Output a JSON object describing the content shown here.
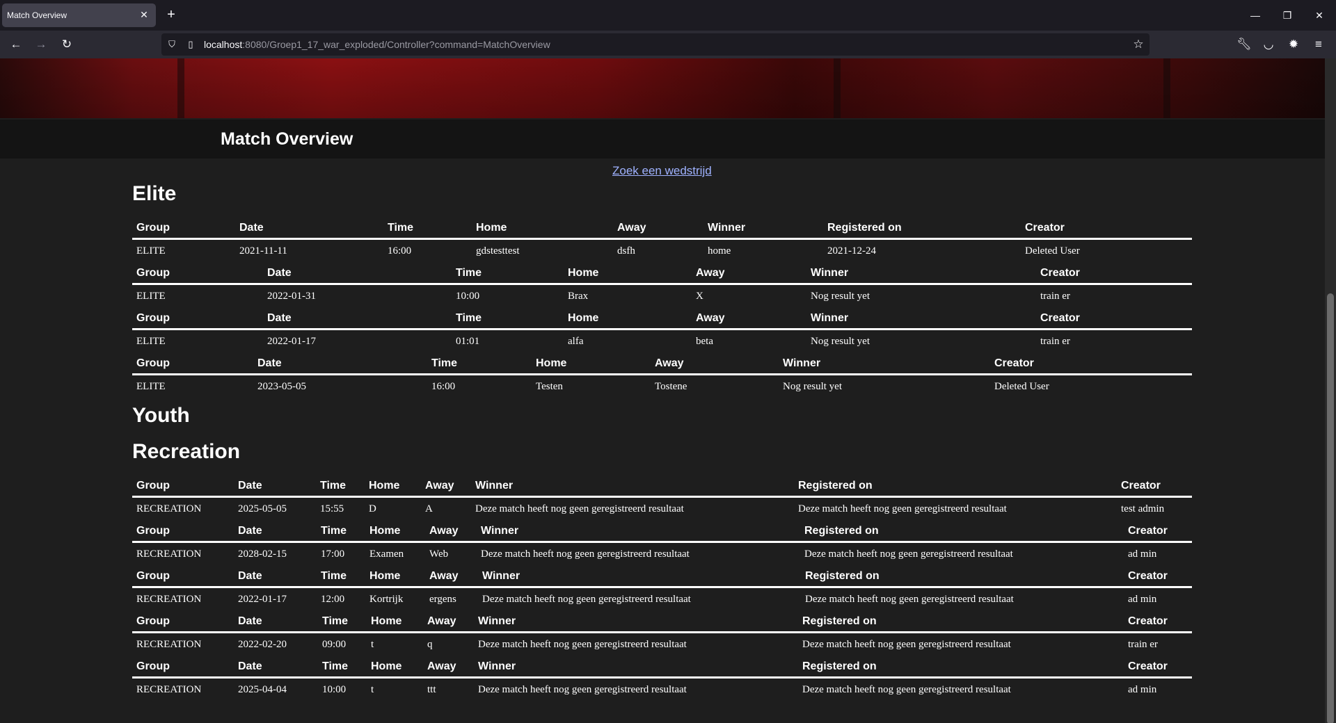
{
  "browser": {
    "tab_title": "Match Overview",
    "url_host": "localhost",
    "url_rest": ":8080/Groep1_17_war_exploded/Controller?command=MatchOverview"
  },
  "page": {
    "title": "Match Overview",
    "search_link": "Zoek een wedstrijd"
  },
  "headers": {
    "group": "Group",
    "date": "Date",
    "time": "Time",
    "home": "Home",
    "away": "Away",
    "winner": "Winner",
    "registered": "Registered on",
    "creator": "Creator"
  },
  "sections": {
    "elite": {
      "title": "Elite",
      "matches": [
        {
          "group": "ELITE",
          "date": "2021-11-11",
          "time": "16:00",
          "home": "gdstesttest",
          "away": "dsfh",
          "winner": "home",
          "registered": "2021-12-24",
          "creator": "Deleted User"
        },
        {
          "group": "ELITE",
          "date": "2022-01-31",
          "time": "10:00",
          "home": "Brax",
          "away": "X",
          "winner": "Nog result yet",
          "creator": "train er"
        },
        {
          "group": "ELITE",
          "date": "2022-01-17",
          "time": "01:01",
          "home": "alfa",
          "away": "beta",
          "winner": "Nog result yet",
          "creator": "train er"
        },
        {
          "group": "ELITE",
          "date": "2023-05-05",
          "time": "16:00",
          "home": "Testen",
          "away": "Tostene",
          "winner": "Nog result yet",
          "creator": "Deleted User"
        }
      ]
    },
    "youth": {
      "title": "Youth"
    },
    "recreation": {
      "title": "Recreation",
      "matches": [
        {
          "group": "RECREATION",
          "date": "2025-05-05",
          "time": "15:55",
          "home": "D",
          "away": "A",
          "winner": "Deze match heeft nog geen geregistreerd resultaat",
          "registered": "Deze match heeft nog geen geregistreerd resultaat",
          "creator": "test admin"
        },
        {
          "group": "RECREATION",
          "date": "2028-02-15",
          "time": "17:00",
          "home": "Examen",
          "away": "Web",
          "winner": "Deze match heeft nog geen geregistreerd resultaat",
          "registered": "Deze match heeft nog geen geregistreerd resultaat",
          "creator": "ad min"
        },
        {
          "group": "RECREATION",
          "date": "2022-01-17",
          "time": "12:00",
          "home": "Kortrijk",
          "away": "ergens",
          "winner": "Deze match heeft nog geen geregistreerd resultaat",
          "registered": "Deze match heeft nog geen geregistreerd resultaat",
          "creator": "ad min"
        },
        {
          "group": "RECREATION",
          "date": "2022-02-20",
          "time": "09:00",
          "home": "t",
          "away": "q",
          "winner": "Deze match heeft nog geen geregistreerd resultaat",
          "registered": "Deze match heeft nog geen geregistreerd resultaat",
          "creator": "train er"
        },
        {
          "group": "RECREATION",
          "date": "2025-04-04",
          "time": "10:00",
          "home": "t",
          "away": "ttt",
          "winner": "Deze match heeft nog geen geregistreerd resultaat",
          "registered": "Deze match heeft nog geen geregistreerd resultaat",
          "creator": "ad min"
        }
      ]
    }
  }
}
